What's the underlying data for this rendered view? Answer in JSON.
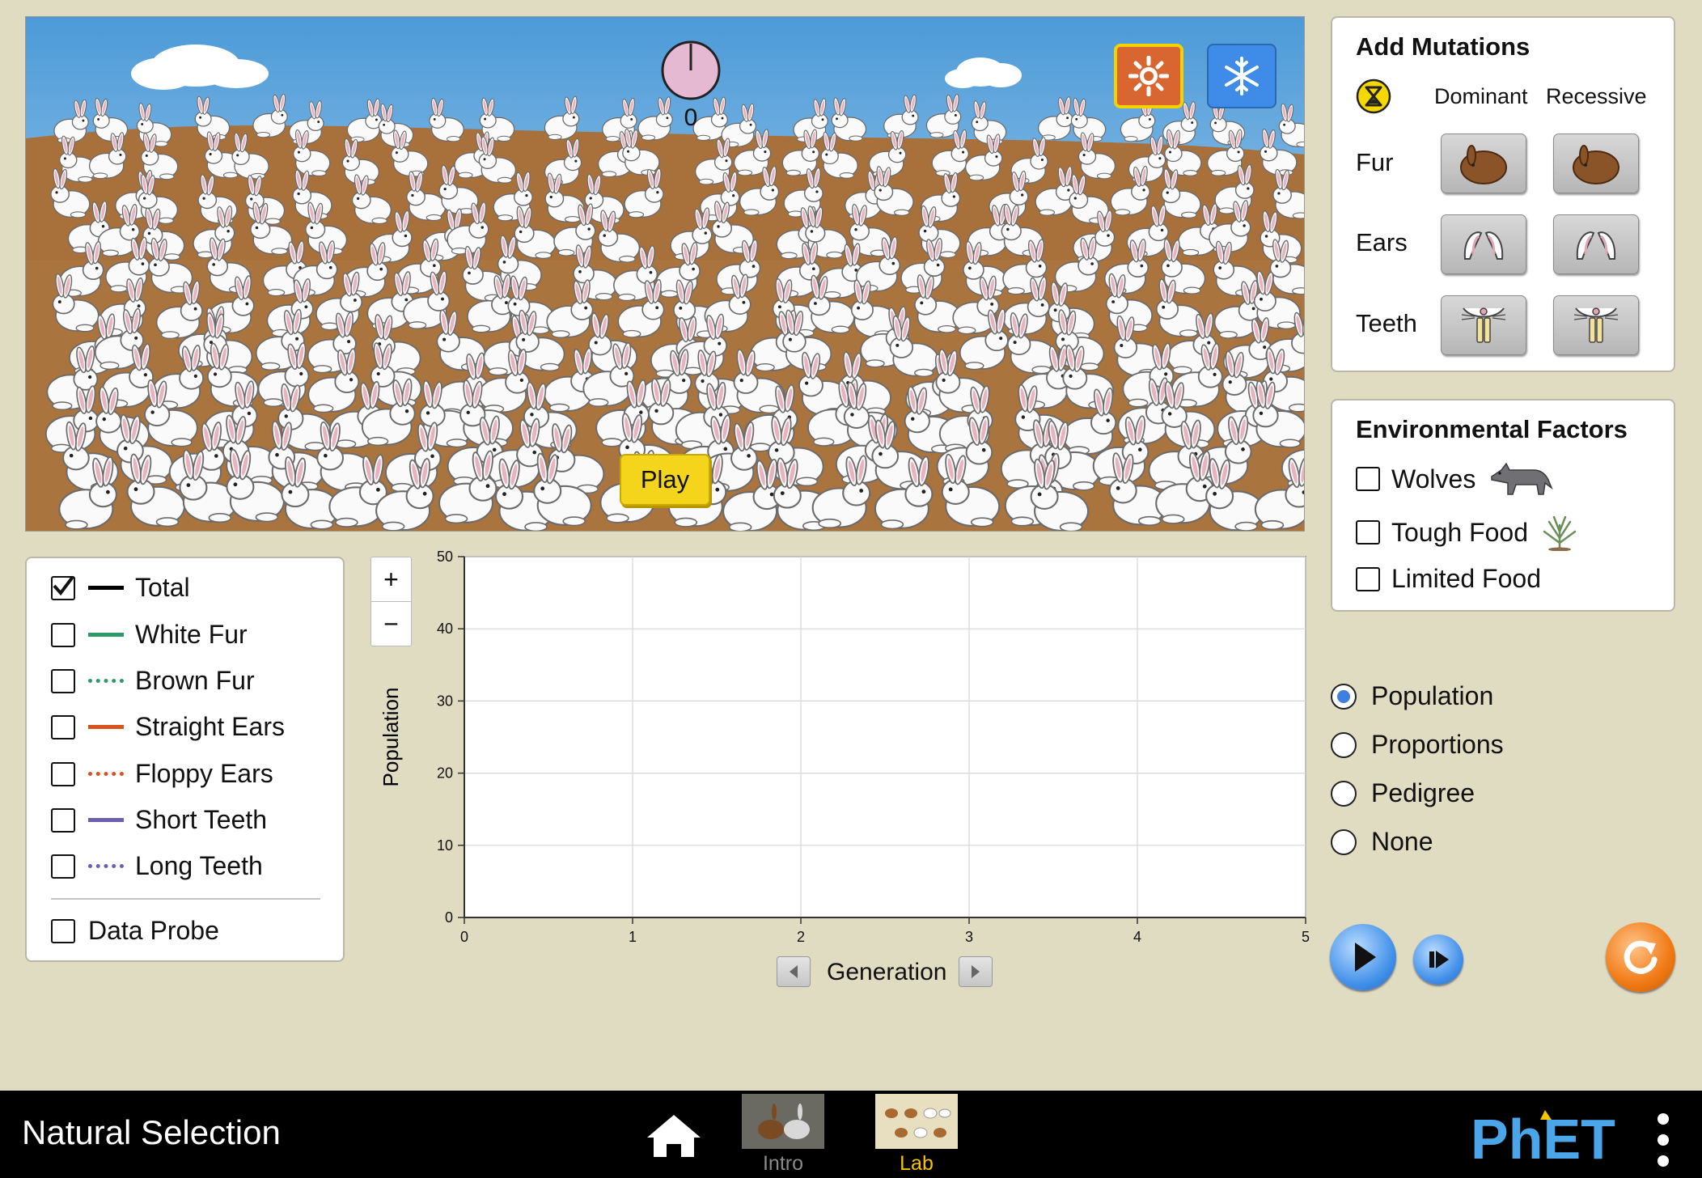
{
  "scene": {
    "generation_count": "0",
    "play_label": "Play",
    "environments": [
      {
        "name": "equator",
        "icon": "sun-icon",
        "selected": true
      },
      {
        "name": "arctic",
        "icon": "snowflake-icon",
        "selected": false
      }
    ],
    "bunny_fur": "white"
  },
  "mutations": {
    "title": "Add Mutations",
    "dominant_header": "Dominant",
    "recessive_header": "Recessive",
    "traits": [
      {
        "label": "Fur",
        "icon": "brown-fur-icon"
      },
      {
        "label": "Ears",
        "icon": "floppy-ears-icon"
      },
      {
        "label": "Teeth",
        "icon": "long-teeth-icon"
      }
    ]
  },
  "environmental_factors": {
    "title": "Environmental Factors",
    "items": [
      {
        "label": "Wolves",
        "checked": false,
        "icon": "wolf-icon"
      },
      {
        "label": "Tough Food",
        "checked": false,
        "icon": "shrub-icon"
      },
      {
        "label": "Limited Food",
        "checked": false
      }
    ]
  },
  "graph_choice": {
    "options": [
      "Population",
      "Proportions",
      "Pedigree",
      "None"
    ],
    "selected": "Population"
  },
  "legend": {
    "items": [
      {
        "label": "Total",
        "checked": true,
        "color": "#000000",
        "style": "solid"
      },
      {
        "label": "White Fur",
        "checked": false,
        "color": "#2e9a6a",
        "style": "solid"
      },
      {
        "label": "Brown Fur",
        "checked": false,
        "color": "#2e9a6a",
        "style": "dotted"
      },
      {
        "label": "Straight Ears",
        "checked": false,
        "color": "#d9531e",
        "style": "solid"
      },
      {
        "label": "Floppy Ears",
        "checked": false,
        "color": "#d9531e",
        "style": "dotted"
      },
      {
        "label": "Short Teeth",
        "checked": false,
        "color": "#6a5fb0",
        "style": "solid"
      },
      {
        "label": "Long Teeth",
        "checked": false,
        "color": "#6a5fb0",
        "style": "dotted"
      }
    ],
    "data_probe": {
      "label": "Data Probe",
      "checked": false
    }
  },
  "zoom": {
    "in_label": "+",
    "out_label": "−"
  },
  "chart_data": {
    "type": "line",
    "xlabel": "Generation",
    "ylabel": "Population",
    "xlim": [
      0,
      5
    ],
    "ylim": [
      0,
      50
    ],
    "x_ticks": [
      "0",
      "1",
      "2",
      "3",
      "4",
      "5"
    ],
    "y_ticks": [
      "0",
      "10",
      "20",
      "30",
      "40",
      "50"
    ],
    "grid": true,
    "series": []
  },
  "navbar": {
    "title": "Natural Selection",
    "screens": [
      {
        "label": "Intro",
        "active": false
      },
      {
        "label": "Lab",
        "active": true
      }
    ],
    "logo_text": "PhET",
    "colors": {
      "active_tab": "#f5c400",
      "inactive_tab": "#8a8a8a"
    }
  }
}
